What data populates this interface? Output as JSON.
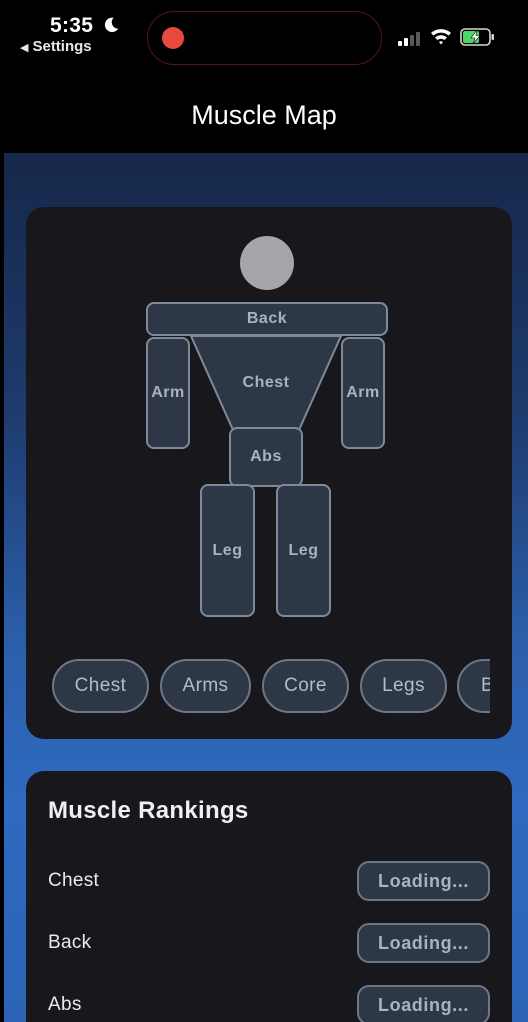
{
  "status_bar": {
    "time": "5:35",
    "back_label": "Settings",
    "recording_color": "#e8493f",
    "battery_color": "#4cd964",
    "icons": [
      "moon-icon",
      "signal-icon",
      "wifi-icon",
      "battery-charging-icon"
    ]
  },
  "header": {
    "title": "Muscle Map"
  },
  "muscle_map": {
    "parts": {
      "back": "Back",
      "chest": "Chest",
      "arm_left": "Arm",
      "arm_right": "Arm",
      "abs": "Abs",
      "leg_left": "Leg",
      "leg_right": "Leg"
    },
    "filters": [
      "Chest",
      "Arms",
      "Core",
      "Legs",
      "B"
    ]
  },
  "rankings": {
    "title": "Muscle Rankings",
    "items": [
      {
        "name": "Chest",
        "status": "Loading..."
      },
      {
        "name": "Back",
        "status": "Loading..."
      },
      {
        "name": "Abs",
        "status": "Loading..."
      }
    ]
  },
  "colors": {
    "card": "#17171c",
    "part_fill": "#2d3746",
    "part_border": "#7e8a9a",
    "gradient_top": "#16284a",
    "gradient_bottom": "#2c63b5"
  }
}
